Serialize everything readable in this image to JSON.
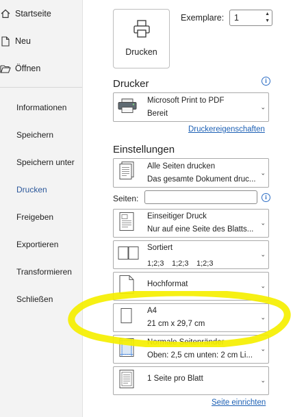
{
  "sidebar": {
    "top_items": [
      {
        "label": "Startseite",
        "icon": "home-icon"
      },
      {
        "label": "Neu",
        "icon": "new-document-icon"
      },
      {
        "label": "Öffnen",
        "icon": "folder-open-icon"
      }
    ],
    "items": [
      {
        "label": "Informationen"
      },
      {
        "label": "Speichern"
      },
      {
        "label": "Speichern unter"
      },
      {
        "label": "Drucken",
        "active": true
      },
      {
        "label": "Freigeben"
      },
      {
        "label": "Exportieren"
      },
      {
        "label": "Transformieren"
      },
      {
        "label": "Schließen"
      }
    ]
  },
  "print": {
    "button_label": "Drucken",
    "copies_label": "Exemplare:",
    "copies_value": "1"
  },
  "printer": {
    "section_title": "Drucker",
    "name": "Microsoft Print to PDF",
    "status": "Bereit",
    "properties_link": "Druckereigenschaften"
  },
  "settings": {
    "section_title": "Einstellungen",
    "pages_label": "Seiten:",
    "pages_value": "",
    "dropdowns": [
      {
        "l1": "Alle Seiten drucken",
        "l2": "Das gesamte Dokument druc...",
        "icon": "pages-icon"
      },
      {
        "l1": "Einseitiger Druck",
        "l2": "Nur auf eine Seite des Blatts...",
        "icon": "one-sided-icon"
      },
      {
        "l1": "Sortiert",
        "l2": "1;2;3",
        "icon": "collate-icon"
      },
      {
        "l1": "Hochformat",
        "l2": "",
        "icon": "portrait-icon"
      },
      {
        "l1": "A4",
        "l2": "21 cm x 29,7 cm",
        "icon": "paper-size-icon"
      },
      {
        "l1": "Normale Seitenränder",
        "l2": "Oben: 2,5 cm unten: 2 cm Li...",
        "icon": "margins-icon"
      },
      {
        "l1": "1 Seite pro Blatt",
        "l2": "",
        "icon": "pages-per-sheet-icon"
      }
    ],
    "page_setup_link": "Seite einrichten"
  },
  "colors": {
    "accent": "#2b579a",
    "link": "#1b5fb4",
    "highlight": "#f5ef00"
  }
}
